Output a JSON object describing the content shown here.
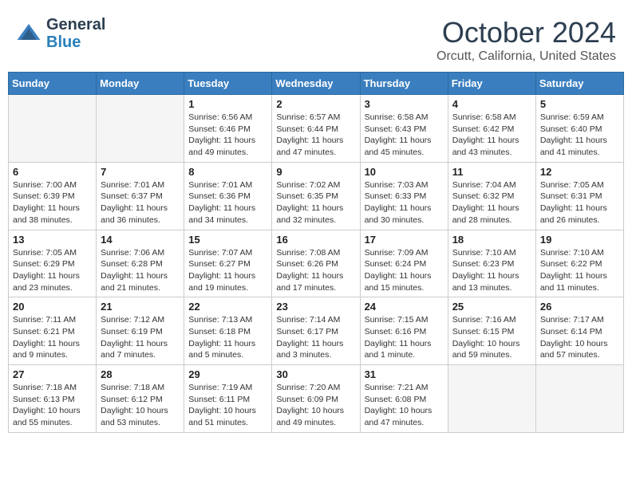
{
  "header": {
    "logo_general": "General",
    "logo_blue": "Blue",
    "month": "October 2024",
    "location": "Orcutt, California, United States"
  },
  "weekdays": [
    "Sunday",
    "Monday",
    "Tuesday",
    "Wednesday",
    "Thursday",
    "Friday",
    "Saturday"
  ],
  "weeks": [
    [
      {
        "day": "",
        "empty": true
      },
      {
        "day": "",
        "empty": true
      },
      {
        "day": "1",
        "sunrise": "Sunrise: 6:56 AM",
        "sunset": "Sunset: 6:46 PM",
        "daylight": "Daylight: 11 hours and 49 minutes."
      },
      {
        "day": "2",
        "sunrise": "Sunrise: 6:57 AM",
        "sunset": "Sunset: 6:44 PM",
        "daylight": "Daylight: 11 hours and 47 minutes."
      },
      {
        "day": "3",
        "sunrise": "Sunrise: 6:58 AM",
        "sunset": "Sunset: 6:43 PM",
        "daylight": "Daylight: 11 hours and 45 minutes."
      },
      {
        "day": "4",
        "sunrise": "Sunrise: 6:58 AM",
        "sunset": "Sunset: 6:42 PM",
        "daylight": "Daylight: 11 hours and 43 minutes."
      },
      {
        "day": "5",
        "sunrise": "Sunrise: 6:59 AM",
        "sunset": "Sunset: 6:40 PM",
        "daylight": "Daylight: 11 hours and 41 minutes."
      }
    ],
    [
      {
        "day": "6",
        "sunrise": "Sunrise: 7:00 AM",
        "sunset": "Sunset: 6:39 PM",
        "daylight": "Daylight: 11 hours and 38 minutes."
      },
      {
        "day": "7",
        "sunrise": "Sunrise: 7:01 AM",
        "sunset": "Sunset: 6:37 PM",
        "daylight": "Daylight: 11 hours and 36 minutes."
      },
      {
        "day": "8",
        "sunrise": "Sunrise: 7:01 AM",
        "sunset": "Sunset: 6:36 PM",
        "daylight": "Daylight: 11 hours and 34 minutes."
      },
      {
        "day": "9",
        "sunrise": "Sunrise: 7:02 AM",
        "sunset": "Sunset: 6:35 PM",
        "daylight": "Daylight: 11 hours and 32 minutes."
      },
      {
        "day": "10",
        "sunrise": "Sunrise: 7:03 AM",
        "sunset": "Sunset: 6:33 PM",
        "daylight": "Daylight: 11 hours and 30 minutes."
      },
      {
        "day": "11",
        "sunrise": "Sunrise: 7:04 AM",
        "sunset": "Sunset: 6:32 PM",
        "daylight": "Daylight: 11 hours and 28 minutes."
      },
      {
        "day": "12",
        "sunrise": "Sunrise: 7:05 AM",
        "sunset": "Sunset: 6:31 PM",
        "daylight": "Daylight: 11 hours and 26 minutes."
      }
    ],
    [
      {
        "day": "13",
        "sunrise": "Sunrise: 7:05 AM",
        "sunset": "Sunset: 6:29 PM",
        "daylight": "Daylight: 11 hours and 23 minutes."
      },
      {
        "day": "14",
        "sunrise": "Sunrise: 7:06 AM",
        "sunset": "Sunset: 6:28 PM",
        "daylight": "Daylight: 11 hours and 21 minutes."
      },
      {
        "day": "15",
        "sunrise": "Sunrise: 7:07 AM",
        "sunset": "Sunset: 6:27 PM",
        "daylight": "Daylight: 11 hours and 19 minutes."
      },
      {
        "day": "16",
        "sunrise": "Sunrise: 7:08 AM",
        "sunset": "Sunset: 6:26 PM",
        "daylight": "Daylight: 11 hours and 17 minutes."
      },
      {
        "day": "17",
        "sunrise": "Sunrise: 7:09 AM",
        "sunset": "Sunset: 6:24 PM",
        "daylight": "Daylight: 11 hours and 15 minutes."
      },
      {
        "day": "18",
        "sunrise": "Sunrise: 7:10 AM",
        "sunset": "Sunset: 6:23 PM",
        "daylight": "Daylight: 11 hours and 13 minutes."
      },
      {
        "day": "19",
        "sunrise": "Sunrise: 7:10 AM",
        "sunset": "Sunset: 6:22 PM",
        "daylight": "Daylight: 11 hours and 11 minutes."
      }
    ],
    [
      {
        "day": "20",
        "sunrise": "Sunrise: 7:11 AM",
        "sunset": "Sunset: 6:21 PM",
        "daylight": "Daylight: 11 hours and 9 minutes."
      },
      {
        "day": "21",
        "sunrise": "Sunrise: 7:12 AM",
        "sunset": "Sunset: 6:19 PM",
        "daylight": "Daylight: 11 hours and 7 minutes."
      },
      {
        "day": "22",
        "sunrise": "Sunrise: 7:13 AM",
        "sunset": "Sunset: 6:18 PM",
        "daylight": "Daylight: 11 hours and 5 minutes."
      },
      {
        "day": "23",
        "sunrise": "Sunrise: 7:14 AM",
        "sunset": "Sunset: 6:17 PM",
        "daylight": "Daylight: 11 hours and 3 minutes."
      },
      {
        "day": "24",
        "sunrise": "Sunrise: 7:15 AM",
        "sunset": "Sunset: 6:16 PM",
        "daylight": "Daylight: 11 hours and 1 minute."
      },
      {
        "day": "25",
        "sunrise": "Sunrise: 7:16 AM",
        "sunset": "Sunset: 6:15 PM",
        "daylight": "Daylight: 10 hours and 59 minutes."
      },
      {
        "day": "26",
        "sunrise": "Sunrise: 7:17 AM",
        "sunset": "Sunset: 6:14 PM",
        "daylight": "Daylight: 10 hours and 57 minutes."
      }
    ],
    [
      {
        "day": "27",
        "sunrise": "Sunrise: 7:18 AM",
        "sunset": "Sunset: 6:13 PM",
        "daylight": "Daylight: 10 hours and 55 minutes."
      },
      {
        "day": "28",
        "sunrise": "Sunrise: 7:18 AM",
        "sunset": "Sunset: 6:12 PM",
        "daylight": "Daylight: 10 hours and 53 minutes."
      },
      {
        "day": "29",
        "sunrise": "Sunrise: 7:19 AM",
        "sunset": "Sunset: 6:11 PM",
        "daylight": "Daylight: 10 hours and 51 minutes."
      },
      {
        "day": "30",
        "sunrise": "Sunrise: 7:20 AM",
        "sunset": "Sunset: 6:09 PM",
        "daylight": "Daylight: 10 hours and 49 minutes."
      },
      {
        "day": "31",
        "sunrise": "Sunrise: 7:21 AM",
        "sunset": "Sunset: 6:08 PM",
        "daylight": "Daylight: 10 hours and 47 minutes."
      },
      {
        "day": "",
        "empty": true
      },
      {
        "day": "",
        "empty": true
      }
    ]
  ]
}
